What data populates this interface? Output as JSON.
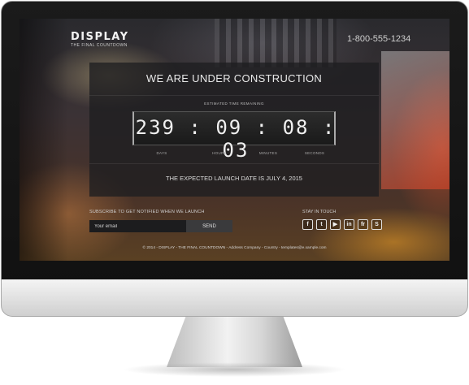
{
  "site": {
    "logo": "DISPLAY",
    "tagline": "THE FINAL COUNTDOWN",
    "phone": "1-800-555-1234"
  },
  "panel": {
    "title": "WE ARE UNDER CONSTRUCTION",
    "estimated_label": "ESTIMATED TIME REMAINING",
    "countdown": "239 : 09 : 08 : 03",
    "units": {
      "days": "DAYS",
      "hours": "HOURS",
      "minutes": "MINUTES",
      "seconds": "SECONDS"
    },
    "launch_text": "THE EXPECTED LAUNCH DATE IS JULY 4, 2015"
  },
  "subscribe": {
    "label": "SUBSCRIBE TO GET NOTIFIED WHEN WE LAUNCH",
    "placeholder": "Your email",
    "button": "SEND"
  },
  "social": {
    "label": "STAY IN TOUCH",
    "icons": [
      {
        "name": "facebook-icon",
        "glyph": "f"
      },
      {
        "name": "twitter-icon",
        "glyph": "t"
      },
      {
        "name": "youtube-icon",
        "glyph": "▶"
      },
      {
        "name": "linkedin-icon",
        "glyph": "in"
      },
      {
        "name": "flickr-icon",
        "glyph": "fr"
      },
      {
        "name": "skype-icon",
        "glyph": "S"
      }
    ]
  },
  "footer": "© 2014 - DISPLAY - THE FINAL COUNTDOWN - Address Company - Country - templates@e.xample.com"
}
